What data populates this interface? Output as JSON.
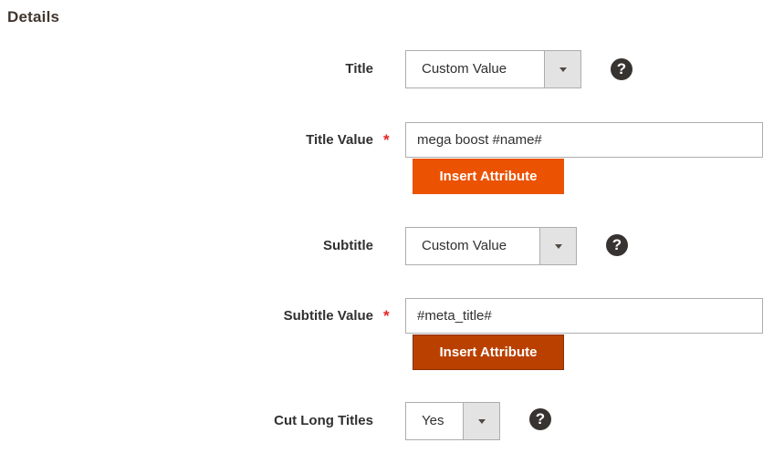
{
  "section": {
    "title": "Details"
  },
  "fields": {
    "title": {
      "label": "Title",
      "value": "Custom Value"
    },
    "title_value": {
      "label": "Title Value",
      "required": "*",
      "value": "mega boost #name#",
      "button_label": "Insert Attribute"
    },
    "subtitle": {
      "label": "Subtitle",
      "value": "Custom Value"
    },
    "subtitle_value": {
      "label": "Subtitle Value",
      "required": "*",
      "value": "#meta_title#",
      "button_label": "Insert Attribute"
    },
    "cut_long_titles": {
      "label": "Cut Long Titles",
      "value": "Yes"
    }
  },
  "help_glyph": "?",
  "icons": {
    "help": "question-circle-icon",
    "dropdown": "chevron-down-icon"
  },
  "colors": {
    "accent": "#eb5202",
    "accent_pressed": "#ba4000",
    "required": "#e22626",
    "help_bg": "#373330"
  }
}
